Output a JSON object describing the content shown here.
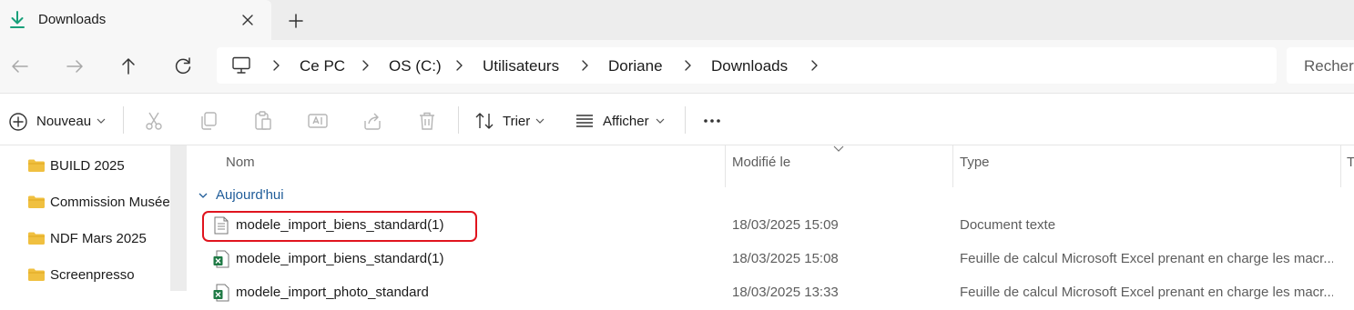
{
  "tab": {
    "title": "Downloads",
    "close_icon": "close-icon",
    "new_tab_icon": "plus-icon"
  },
  "navigation": {
    "back_icon": "arrow-left-icon",
    "forward_icon": "arrow-right-icon",
    "up_icon": "arrow-up-icon",
    "refresh_icon": "refresh-icon"
  },
  "breadcrumb": {
    "root_icon": "computer-icon",
    "items": [
      "Ce PC",
      "OS (C:)",
      "Utilisateurs",
      "Doriane",
      "Downloads"
    ]
  },
  "search": {
    "placeholder": "Recherc"
  },
  "toolbar": {
    "new_label": "Nouveau",
    "sort_label": "Trier",
    "view_label": "Afficher",
    "more_icon": "more-icon"
  },
  "sidebar": {
    "items": [
      {
        "label": "BUILD 2025"
      },
      {
        "label": "Commission Musées"
      },
      {
        "label": "NDF Mars 2025"
      },
      {
        "label": "Screenpresso"
      }
    ]
  },
  "columns": {
    "name": "Nom",
    "modified": "Modifié le",
    "type": "Type",
    "size": "Ta"
  },
  "group": {
    "label": "Aujourd'hui"
  },
  "files": [
    {
      "name": "modele_import_biens_standard(1)",
      "modified": "18/03/2025 15:09",
      "type": "Document texte",
      "icon": "text-file-icon"
    },
    {
      "name": "modele_import_biens_standard(1)",
      "modified": "18/03/2025 15:08",
      "type": "Feuille de calcul Microsoft Excel prenant en charge les macr...",
      "icon": "excel-file-icon"
    },
    {
      "name": "modele_import_photo_standard",
      "modified": "18/03/2025 13:33",
      "type": "Feuille de calcul Microsoft Excel prenant en charge les macr...",
      "icon": "excel-file-icon"
    }
  ],
  "colors": {
    "accent": "#1f5c99",
    "highlight": "#e0141e",
    "folder": "#f0c040",
    "excel": "#1f7a45",
    "download": "#18a07a"
  }
}
